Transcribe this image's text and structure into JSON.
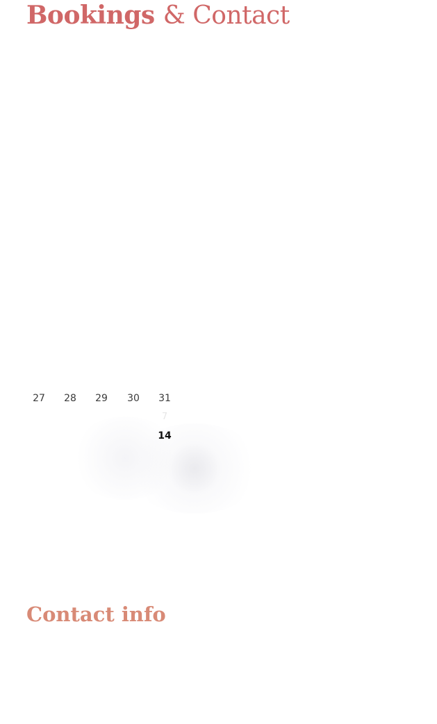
{
  "header": {
    "title_strong": "Bookings",
    "title_light": "& Contact"
  },
  "calendar": {
    "row1": [
      "27",
      "28",
      "29",
      "30",
      "31"
    ],
    "row2_last": "7",
    "row3_last": "14"
  },
  "contact": {
    "title": "Contact info"
  },
  "colors": {
    "title_accent": "#d06767",
    "section_accent": "#d88a76",
    "text": "#3a3a3a"
  }
}
